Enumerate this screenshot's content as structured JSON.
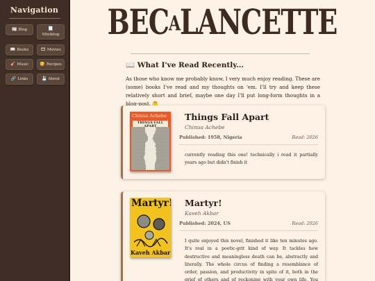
{
  "sidebar": {
    "title": "Navigation",
    "items": [
      {
        "label": "Blog",
        "icon": "📰"
      },
      {
        "label": "Miniblog",
        "icon": "📃"
      },
      {
        "label": "Books",
        "icon": "📖"
      },
      {
        "label": "Movies",
        "icon": "🎞"
      },
      {
        "label": "Music",
        "icon": "🎸"
      },
      {
        "label": "Recipes",
        "icon": "😋"
      },
      {
        "label": "Links",
        "icon": "🔗"
      },
      {
        "label": "About",
        "icon": "💾"
      }
    ]
  },
  "header": {
    "logo_part1": "Bec",
    "logo_part2": "a",
    "logo_part3": "Lancette"
  },
  "main": {
    "section_icon": "📖",
    "section_title": "What I've Read Recently...",
    "intro": "As those who know me probably know, I very much enjoy reading. These are (some) books I've read and my thoughts on 'em. I'll try and keep these relatively short and brief, maybe one day I'll put long-form thoughts in a blog-post. 🤔"
  },
  "books": [
    {
      "title": "Things Fall Apart",
      "author": "Chinua Achebe",
      "published": "Published: 1958, Nigeria",
      "read": "Read: 2026",
      "review": "currently reading this one! technically i read it partially years ago but didn't finish it",
      "cover_author": "Chinua Achebe",
      "cover_title": "THINGS FALL APART",
      "cover_color": "#e85a2c"
    },
    {
      "title": "Martyr!",
      "author": "Kaveh Akbar",
      "published": "Published: 2024, US",
      "read": "Read: 2026",
      "review": "I quite enjoyed this novel, finished it like ten minutes ago. It's real in a poetic-grit kind of way. It tackles how destructive and meaningless death can be, abstractly and literally. The whole circus of finding a resemblance of order, passion, and productivity in spite of it, both in the grief of others and of reckoning with your own life. You may assume that this is",
      "cover_title": "Martyr!",
      "cover_author": "Kaveh Akbar",
      "cover_color": "#f2c21f"
    }
  ]
}
